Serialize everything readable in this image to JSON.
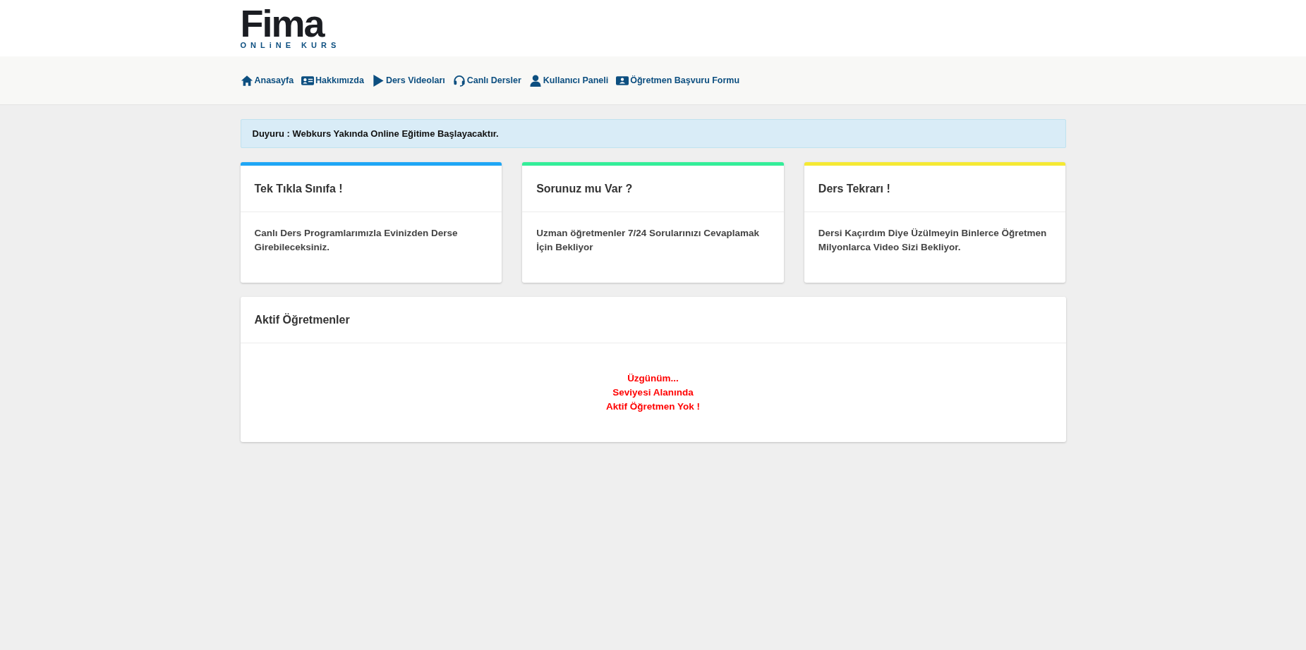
{
  "logo": {
    "name": "Fima",
    "subtitle": "ONLiNE KURS"
  },
  "nav": [
    {
      "label": "Anasayfa",
      "kind": "home"
    },
    {
      "label": "Hakkımızda",
      "kind": "card"
    },
    {
      "label": "Ders Videoları",
      "kind": "play"
    },
    {
      "label": "Canlı Dersler",
      "kind": "headset"
    },
    {
      "label": "Kullanıcı Paneli",
      "kind": "user"
    },
    {
      "label": "Öğretmen Başvuru Formu",
      "kind": "badge"
    }
  ],
  "announcement": "Duyuru : Webkurs Yakında Online Eğitime Başlayacaktır.",
  "cards": [
    {
      "title": "Tek Tıkla Sınıfa !",
      "text": "Canlı Ders Programlarımızla Evinizden Derse Girebileceksiniz.",
      "color": "#1fa6f5"
    },
    {
      "title": "Sorunuz mu Var ?",
      "text": "Uzman öğretmenler 7/24 Sorularınızı Cevaplamak İçin Bekliyor",
      "color": "#33ee99"
    },
    {
      "title": "Ders Tekrarı !",
      "text": "Dersi Kaçırdım Diye Üzülmeyin Binlerce Öğretmen Milyonlarca Video Sizi Bekliyor.",
      "color": "#f5e933"
    }
  ],
  "teachers_panel": {
    "title": "Aktif Öğretmenler",
    "message": [
      "Üzgünüm...",
      "Seviyesi Alanında",
      "Aktif Öğretmen Yok !"
    ]
  }
}
